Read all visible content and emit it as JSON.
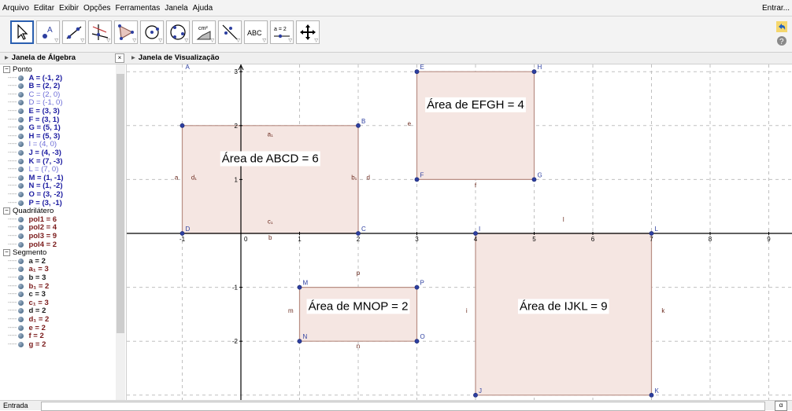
{
  "menu": {
    "items": [
      "Arquivo",
      "Editar",
      "Exibir",
      "Opções",
      "Ferramentas",
      "Janela",
      "Ajuda"
    ],
    "login": "Entrar..."
  },
  "toolbar": {
    "tools": [
      {
        "name": "move-tool-icon",
        "active": true
      },
      {
        "name": "point-tool-icon",
        "label": "A"
      },
      {
        "name": "line-tool-icon"
      },
      {
        "name": "perpendicular-tool-icon"
      },
      {
        "name": "polygon-tool-icon"
      },
      {
        "name": "circle-tool-icon"
      },
      {
        "name": "circle-three-points-tool-icon"
      },
      {
        "name": "angle-tool-icon",
        "label": "cm²"
      },
      {
        "name": "reflect-tool-icon"
      },
      {
        "name": "text-tool-icon",
        "label": "ABC"
      },
      {
        "name": "slider-tool-icon",
        "label": "a = 2"
      },
      {
        "name": "move-view-tool-icon"
      }
    ]
  },
  "panels": {
    "algebra_title": "Janela de Álgebra",
    "graphics_title": "Janela de Visualização"
  },
  "algebra": {
    "groups": [
      {
        "title": "Ponto",
        "items": [
          {
            "text": "A = (-1, 2)",
            "style": "pt"
          },
          {
            "text": "B = (2, 2)",
            "style": "pt"
          },
          {
            "text": "C = (2, 0)",
            "style": "pth"
          },
          {
            "text": "D = (-1, 0)",
            "style": "pth"
          },
          {
            "text": "E = (3, 3)",
            "style": "pt"
          },
          {
            "text": "F = (3, 1)",
            "style": "pt"
          },
          {
            "text": "G = (5, 1)",
            "style": "pt"
          },
          {
            "text": "H = (5, 3)",
            "style": "pt"
          },
          {
            "text": "I = (4, 0)",
            "style": "pth"
          },
          {
            "text": "J = (4, -3)",
            "style": "pt"
          },
          {
            "text": "K = (7, -3)",
            "style": "pt"
          },
          {
            "text": "L = (7, 0)",
            "style": "pth"
          },
          {
            "text": "M = (1, -1)",
            "style": "pt"
          },
          {
            "text": "N = (1, -2)",
            "style": "pt"
          },
          {
            "text": "O = (3, -2)",
            "style": "pt"
          },
          {
            "text": "P = (3, -1)",
            "style": "pt"
          }
        ]
      },
      {
        "title": "Quadrilátero",
        "items": [
          {
            "text": "pol1 = 6",
            "style": "pol"
          },
          {
            "text": "pol2 = 4",
            "style": "pol"
          },
          {
            "text": "pol3 = 9",
            "style": "pol"
          },
          {
            "text": "pol4 = 2",
            "style": "pol"
          }
        ]
      },
      {
        "title": "Segmento",
        "items": [
          {
            "text": "a = 2",
            "style": "seg"
          },
          {
            "text": "a₁ = 3",
            "style": "seg2"
          },
          {
            "text": "b = 3",
            "style": "seg"
          },
          {
            "text": "b₁ = 2",
            "style": "seg2"
          },
          {
            "text": "c = 3",
            "style": "seg"
          },
          {
            "text": "c₁ = 3",
            "style": "seg2"
          },
          {
            "text": "d = 2",
            "style": "seg"
          },
          {
            "text": "d₁ = 2",
            "style": "seg2"
          },
          {
            "text": "e = 2",
            "style": "seg2"
          },
          {
            "text": "f = 2",
            "style": "seg2"
          },
          {
            "text": "g = 2",
            "style": "seg2"
          }
        ]
      }
    ]
  },
  "graphics": {
    "x_ticks": [
      "-1",
      "0",
      "1",
      "2",
      "3",
      "4",
      "5",
      "6",
      "7",
      "8",
      "9"
    ],
    "y_ticks": [
      "3",
      "2",
      "1",
      "-1",
      "-2"
    ],
    "origin_label": "0",
    "points": [
      {
        "label": "A",
        "x": -1,
        "y": 3,
        "dot": false
      },
      {
        "label": "B",
        "x": 2,
        "y": 2,
        "dot": true
      },
      {
        "label": "C",
        "x": 2,
        "y": 0,
        "dot": true
      },
      {
        "label": "D",
        "x": -1,
        "y": 0,
        "dot": true
      },
      {
        "label": "",
        "x": -1,
        "y": 2,
        "dot": true
      },
      {
        "label": "E",
        "x": 3,
        "y": 3,
        "dot": true
      },
      {
        "label": "F",
        "x": 3,
        "y": 1,
        "dot": true
      },
      {
        "label": "G",
        "x": 5,
        "y": 1,
        "dot": true
      },
      {
        "label": "H",
        "x": 5,
        "y": 3,
        "dot": true
      },
      {
        "label": "I",
        "x": 4,
        "y": 0,
        "dot": true
      },
      {
        "label": "J",
        "x": 4,
        "y": -3,
        "dot": true
      },
      {
        "label": "K",
        "x": 7,
        "y": -3,
        "dot": true
      },
      {
        "label": "L",
        "x": 7,
        "y": 0,
        "dot": true
      },
      {
        "label": "M",
        "x": 1,
        "y": -1,
        "dot": true
      },
      {
        "label": "N",
        "x": 1,
        "y": -2,
        "dot": true
      },
      {
        "label": "O",
        "x": 3,
        "y": -2,
        "dot": true
      },
      {
        "label": "P",
        "x": 3,
        "y": -1,
        "dot": true
      }
    ],
    "polygons": [
      {
        "name": "ABCD",
        "pts": [
          [
            -1,
            2
          ],
          [
            2,
            2
          ],
          [
            2,
            0
          ],
          [
            -1,
            0
          ]
        ]
      },
      {
        "name": "EFGH",
        "pts": [
          [
            3,
            3
          ],
          [
            5,
            3
          ],
          [
            5,
            1
          ],
          [
            3,
            1
          ]
        ]
      },
      {
        "name": "IJKL",
        "pts": [
          [
            4,
            0
          ],
          [
            7,
            0
          ],
          [
            7,
            -3
          ],
          [
            4,
            -3
          ]
        ]
      },
      {
        "name": "MNOP",
        "pts": [
          [
            1,
            -1
          ],
          [
            3,
            -1
          ],
          [
            3,
            -2
          ],
          [
            1,
            -2
          ]
        ]
      }
    ],
    "segment_labels": [
      {
        "text": "a",
        "x": -1.1,
        "y": 1.0
      },
      {
        "text": "d₁",
        "x": -0.8,
        "y": 1.0
      },
      {
        "text": "a₁",
        "x": 0.5,
        "y": 1.8
      },
      {
        "text": "c₁",
        "x": 0.5,
        "y": 0.18
      },
      {
        "text": "b₁",
        "x": 1.93,
        "y": 1.0
      },
      {
        "text": "d",
        "x": 2.17,
        "y": 1.0
      },
      {
        "text": "b",
        "x": 0.5,
        "y": -0.12
      },
      {
        "text": "e",
        "x": 2.87,
        "y": 2.0
      },
      {
        "text": "f",
        "x": 4.0,
        "y": 0.85
      },
      {
        "text": "l",
        "x": 5.5,
        "y": 0.22
      },
      {
        "text": "p",
        "x": 2.0,
        "y": -0.77
      },
      {
        "text": "m",
        "x": 0.85,
        "y": -1.47
      },
      {
        "text": "n",
        "x": 2.0,
        "y": -2.13
      },
      {
        "text": "i",
        "x": 3.85,
        "y": -1.47
      },
      {
        "text": "k",
        "x": 7.2,
        "y": -1.47
      }
    ],
    "area_texts": [
      {
        "text": "Área de  ABCD = 6",
        "x": 0.5,
        "y": 1.32
      },
      {
        "text": "Área de  EFGH = 4",
        "x": 4.0,
        "y": 2.32
      },
      {
        "text": "Área de  MNOP = 2",
        "x": 2.0,
        "y": -1.42
      },
      {
        "text": "Área de  IJKL = 9",
        "x": 5.5,
        "y": -1.42
      }
    ]
  },
  "input": {
    "label": "Entrada"
  },
  "colors": {
    "poly_fill": "#f5e6e2",
    "poly_stroke": "#b88e84",
    "point_blue": "#2d3fa0",
    "axis": "#000000",
    "grid": "#c0c0c0"
  }
}
